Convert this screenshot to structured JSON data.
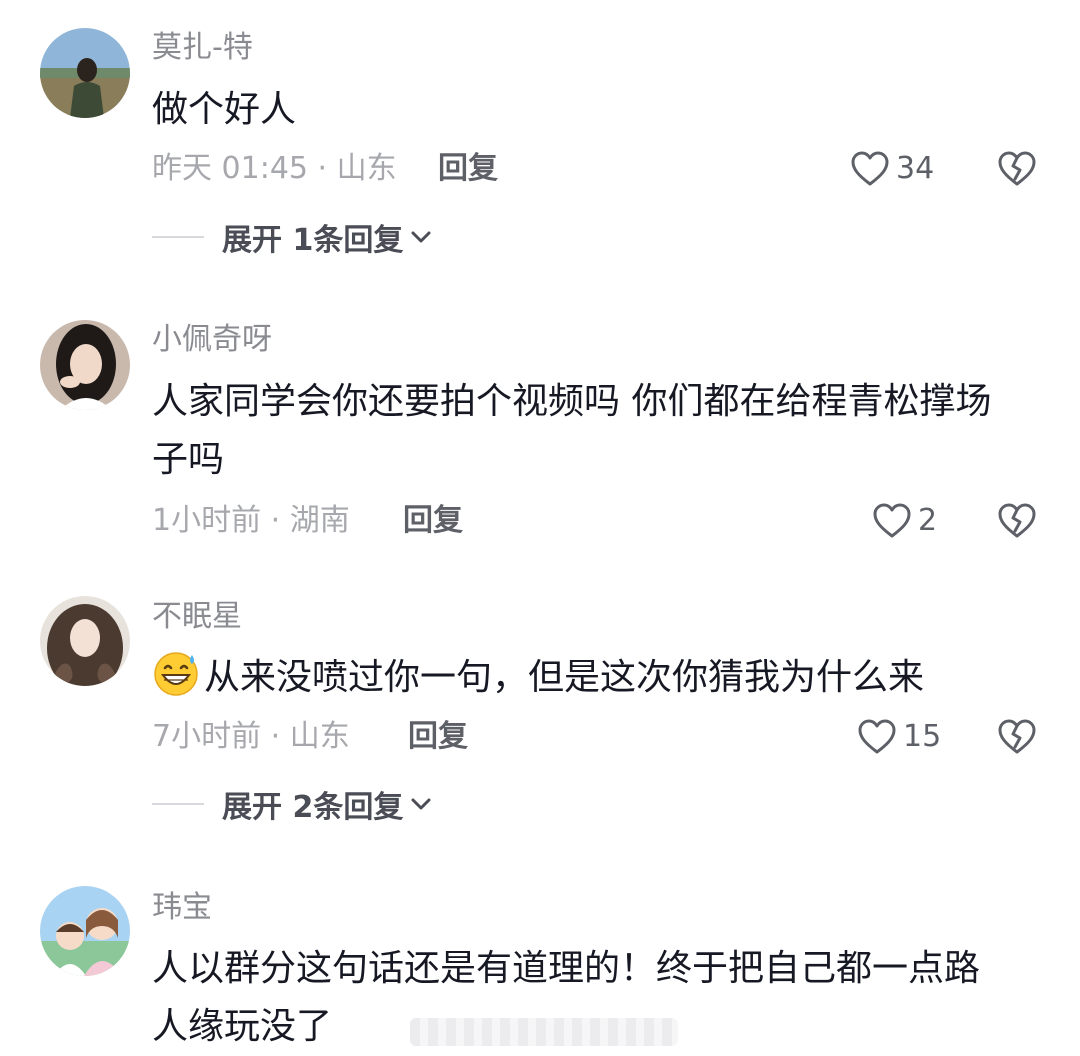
{
  "comments": [
    {
      "username": "莫扎-特",
      "text": "做个好人",
      "meta": "昨天 01:45 · 山东",
      "reply": "回复",
      "likes": "34",
      "expand": "展开 1条回复"
    },
    {
      "username": "小佩奇呀",
      "text_line1": "人家同学会你还要拍个视频吗 你们都在给程青松撑场",
      "text_line2": "子吗",
      "meta": "1小时前 · 湖南",
      "reply": "回复",
      "likes": "2"
    },
    {
      "username": "不眠星",
      "emoji": "grinning-sweat-emoji",
      "text": "从来没喷过你一句，但是这次你猜我为什么来",
      "meta": "7小时前 · 山东",
      "reply": "回复",
      "likes": "15",
      "expand": "展开 2条回复"
    },
    {
      "username": "玮宝",
      "text_line1": "人以群分这句话还是有道理的！终于把自己都一点路",
      "text_line2": "人缘玩没了"
    }
  ],
  "icons": {
    "like": "heart-outline-icon",
    "dislike": "broken-heart-icon",
    "expand": "chevron-down-icon"
  },
  "colors": {
    "username": "#8a8b91",
    "text": "#161823",
    "meta": "#a7a8ad"
  }
}
